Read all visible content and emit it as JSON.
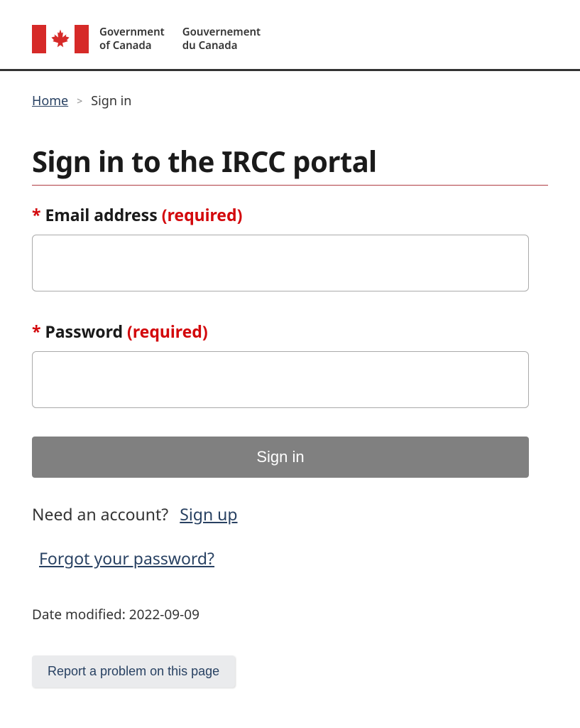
{
  "header": {
    "gov_en_line1": "Government",
    "gov_en_line2": "of Canada",
    "gov_fr_line1": "Gouvernement",
    "gov_fr_line2": "du Canada"
  },
  "breadcrumb": {
    "home": "Home",
    "current": "Sign in"
  },
  "page": {
    "title": "Sign in to the IRCC portal"
  },
  "form": {
    "email_label": "Email address",
    "password_label": "Password",
    "required_text": "(required)",
    "signin_button": "Sign in"
  },
  "links": {
    "need_account_text": "Need an account?",
    "sign_up": "Sign up",
    "forgot_password": "Forgot your password?"
  },
  "footer": {
    "date_modified_label": "Date modified:",
    "date_modified_value": "2022-09-09",
    "report_problem": "Report a problem on this page"
  }
}
